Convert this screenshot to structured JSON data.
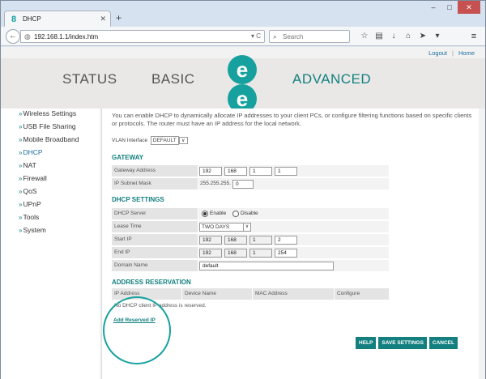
{
  "browser": {
    "tab_title": "DHCP",
    "url": "192.168.1.1/index.htm",
    "search_placeholder": "Search"
  },
  "toplinks": {
    "logout": "Logout",
    "separator": "|",
    "home": "Home"
  },
  "header_nav": {
    "status": "STATUS",
    "basic": "BASIC",
    "advanced": "ADVANCED",
    "logo_letter": "e"
  },
  "sidebar": {
    "items": [
      {
        "label": "Wireless Settings"
      },
      {
        "label": "USB File Sharing"
      },
      {
        "label": "Mobile Broadband"
      },
      {
        "label": "DHCP"
      },
      {
        "label": "NAT"
      },
      {
        "label": "Firewall"
      },
      {
        "label": "QoS"
      },
      {
        "label": "UPnP"
      },
      {
        "label": "Tools"
      },
      {
        "label": "System"
      }
    ]
  },
  "main": {
    "intro": "You can enable DHCP to dynamically allocate IP addresses to your client PCs, or configure filtering functions based on specific clients or protocols. The router must have an IP address for the local network.",
    "vlan_label": "VLAN Interface",
    "vlan_value": "DEFAULT",
    "gateway": {
      "title": "GATEWAY",
      "address_label": "Gateway Address",
      "address": [
        "192",
        "168",
        "1",
        "1"
      ],
      "mask_label": "IP Subnet Mask",
      "mask_prefix": "255.255.255.",
      "mask_last": "0"
    },
    "dhcp": {
      "title": "DHCP SETTINGS",
      "server_label": "DHCP Server",
      "enable": "Enable",
      "disable": "Disable",
      "lease_label": "Lease Time",
      "lease_value": "TWO DAYS",
      "start_label": "Start IP",
      "start": [
        "192",
        "168",
        "1",
        "2"
      ],
      "end_label": "End IP",
      "end": [
        "192",
        "168",
        "1",
        "254"
      ],
      "domain_label": "Domain Name",
      "domain_value": "default"
    },
    "reservation": {
      "title": "ADDRESS RESERVATION",
      "columns": [
        "IP Address",
        "Device Name",
        "MAC Address",
        "Configure"
      ],
      "empty": "No DHCP client IP address is reserved.",
      "add_link": "Add Reserved IP"
    },
    "buttons": {
      "help": "HELP",
      "save": "SAVE SETTINGS",
      "cancel": "CANCEL"
    }
  },
  "colors": {
    "accent": "#13807f",
    "link": "#1a6fa0",
    "highlight_circle": "#16a19f"
  }
}
